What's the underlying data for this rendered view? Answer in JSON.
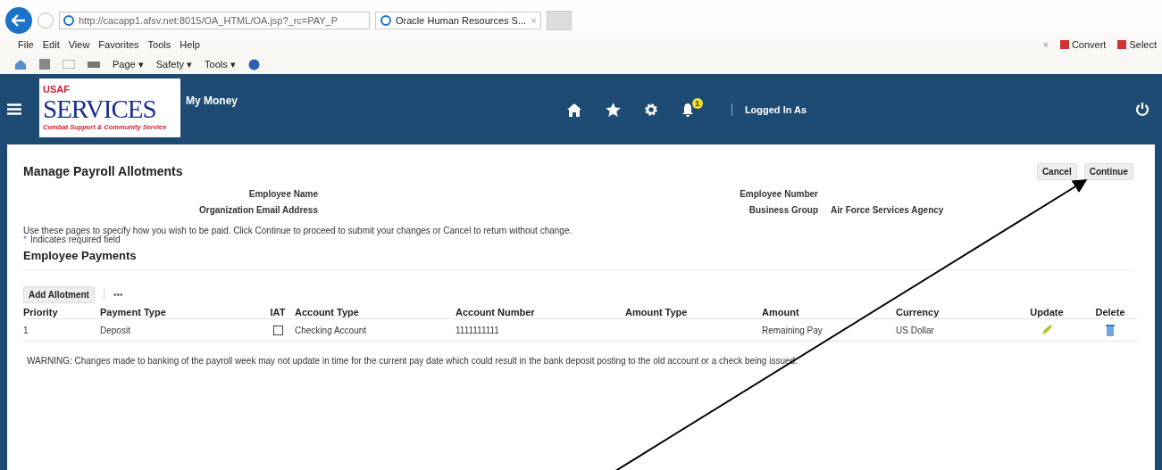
{
  "browser": {
    "address": "http://cacapp1.afsv.net:8015/OA_HTML/OA.jsp?_rc=PAY_P",
    "tab_title": "Oracle Human Resources S...",
    "tab_close": "×",
    "menu": [
      "File",
      "Edit",
      "View",
      "Favorites",
      "Tools",
      "Help"
    ],
    "command_bar": [
      {
        "label": "Page",
        "caret": "▾"
      },
      {
        "label": "Safety",
        "caret": "▾"
      },
      {
        "label": "Tools",
        "caret": "▾"
      }
    ],
    "pdf_close": "×",
    "pdf_tools": [
      "Convert",
      "Select"
    ]
  },
  "header": {
    "logo": {
      "top": "USAF",
      "main": "SERVICES",
      "tagline": "Combat Support & Community Service"
    },
    "app_title": "My Money",
    "notification_count": "1",
    "user": "Logged In As"
  },
  "page": {
    "title": "Manage Payroll Allotments",
    "buttons": [
      "Cancel",
      "Continue"
    ],
    "fields_left": [
      {
        "label": "Employee Name"
      },
      {
        "label": "Organization Email Address"
      }
    ],
    "fields_right": [
      {
        "label": "Employee Number"
      },
      {
        "label": "Business Group",
        "value": "Air Force Services Agency"
      }
    ],
    "instructions": "Use these pages to specify how you wish to be paid. Click Continue to proceed to submit your changes or Cancel to return without change.",
    "required_mark": "*",
    "required_note": "Indicates required field",
    "section": "Employee Payments",
    "toolbar": {
      "add": "Add Allotment",
      "more": "•••"
    },
    "table": {
      "columns": [
        "Priority",
        "Payment Type",
        "IAT",
        "Account Type",
        "Account Number",
        "Amount Type",
        "Amount",
        "Currency",
        "Update",
        "Delete"
      ],
      "rows": [
        {
          "priority": "1",
          "payment_type": "Deposit",
          "iat_checked": false,
          "account_type": "Checking Account",
          "account_number": "1111111111",
          "amount": "Remaining Pay",
          "currency": "US Dollar"
        }
      ]
    },
    "warning": "WARNING: Changes made to banking of the payroll week may not update in time for the current pay date which could result in the bank deposit posting to the old account or a check being issued."
  }
}
